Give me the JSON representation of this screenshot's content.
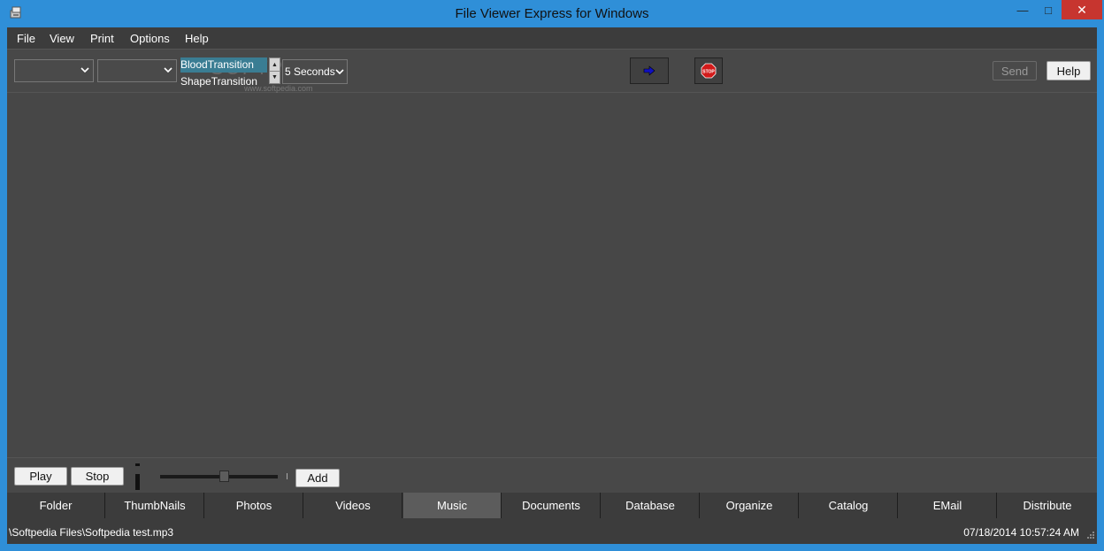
{
  "window": {
    "title": "File Viewer Express for Windows",
    "controls": {
      "minimize": "—",
      "maximize": "□",
      "close": "✕"
    }
  },
  "menu": {
    "items": [
      "File",
      "View",
      "Print",
      "Options",
      "Help"
    ]
  },
  "toolbar": {
    "combo1_value": "",
    "combo2_value": "",
    "transitions": [
      "BloodTransition",
      "ShapeTransition"
    ],
    "selected_transition": "BloodTransition",
    "interval_value": "5 Seconds",
    "watermark": "SOFTPEDIA",
    "watermark_sub": "www.softpedia.com",
    "go_icon": "right-arrow-icon",
    "stop_icon": "stop-sign-icon",
    "stop_icon_text": "STOP",
    "send_label": "Send",
    "help_label": "Help"
  },
  "controls": {
    "play_label": "Play",
    "stop_label": "Stop",
    "add_label": "Add",
    "slider_position": 0.55
  },
  "tabs": {
    "items": [
      "Folder",
      "ThumbNails",
      "Photos",
      "Videos",
      "Music",
      "Documents",
      "Database",
      "Organize",
      "Catalog",
      "EMail",
      "Distribute"
    ],
    "active": "Music"
  },
  "status": {
    "path": "\\Softpedia Files\\Softpedia test.mp3",
    "datetime": "07/18/2014 10:57:24 AM"
  },
  "colors": {
    "titlebar": "#2f8fd8",
    "close_button": "#c7352f",
    "background": "#4a4a4a",
    "highlight": "#3a7d93",
    "go_arrow": "#1010c0",
    "stop_sign": "#d21a1a"
  }
}
